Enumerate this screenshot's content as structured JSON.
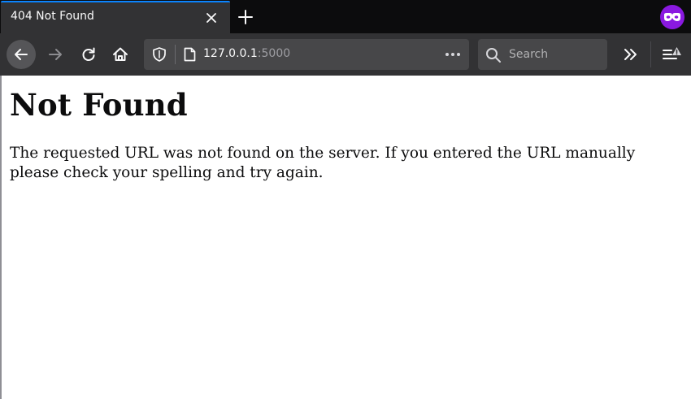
{
  "browser": {
    "tab": {
      "title": "404 Not Found"
    },
    "url": {
      "host": "127.0.0.1",
      "port": ":5000"
    },
    "search": {
      "placeholder": "Search"
    },
    "colors": {
      "tab_accent": "#0a84ff",
      "private_badge": "#8a19e0",
      "menu_warning": "#ffe900"
    },
    "icons": [
      "close-icon",
      "plus-icon",
      "private-browsing-icon",
      "back-arrow-icon",
      "forward-arrow-icon",
      "reload-icon",
      "home-icon",
      "shield-icon",
      "page-icon",
      "more-dots-icon",
      "search-icon",
      "chevron-double-right-icon",
      "hamburger-menu-icon",
      "warning-icon"
    ]
  },
  "page": {
    "heading": "Not Found",
    "message": "The requested URL was not found on the server. If you entered the URL manually please check your spelling and try again."
  }
}
